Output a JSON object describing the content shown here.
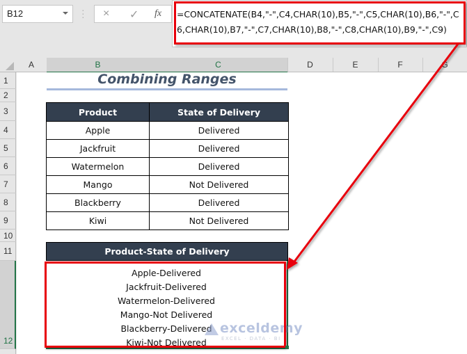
{
  "name_box": {
    "value": "B12"
  },
  "formula_bar": {
    "cancel_icon": "×",
    "enter_icon": "✓",
    "fx_label": "fx",
    "formula": "=CONCATENATE(B4,\"-\",C4,CHAR(10),B5,\"-\",C5,CHAR(10),B6,\"-\",C6,CHAR(10),B7,\"-\",C7,CHAR(10),B8,\"-\",C8,CHAR(10),B9,\"-\",C9)"
  },
  "columns": [
    "A",
    "B",
    "C",
    "D",
    "E",
    "F",
    "G"
  ],
  "rows": [
    "1",
    "2",
    "3",
    "4",
    "5",
    "6",
    "7",
    "8",
    "9",
    "10",
    "11",
    "12"
  ],
  "selected_cell": {
    "column": "B",
    "row": "12"
  },
  "sheet": {
    "title": "Combining Ranges",
    "table": {
      "headers": [
        "Product",
        "State of Delivery"
      ],
      "rows": [
        [
          "Apple",
          "Delivered"
        ],
        [
          "Jackfruit",
          "Delivered"
        ],
        [
          "Watermelon",
          "Delivered"
        ],
        [
          "Mango",
          "Not Delivered"
        ],
        [
          "Blackberry",
          "Delivered"
        ],
        [
          "Kiwi",
          "Not Delivered"
        ]
      ]
    },
    "result": {
      "header": "Product-State of Delivery",
      "lines": [
        "Apple-Delivered",
        "Jackfruit-Delivered",
        "Watermelon-Delivered",
        "Mango-Not Delivered",
        "Blackberry-Delivered",
        "Kiwi-Not Delivered"
      ]
    }
  },
  "watermark": {
    "name": "exceldemy",
    "tagline": "EXCEL · DATA · BI"
  },
  "colors": {
    "header_fill": "#333f4f",
    "highlight_red": "#e8000b",
    "title_color": "#44546a",
    "excel_green": "#217346"
  }
}
